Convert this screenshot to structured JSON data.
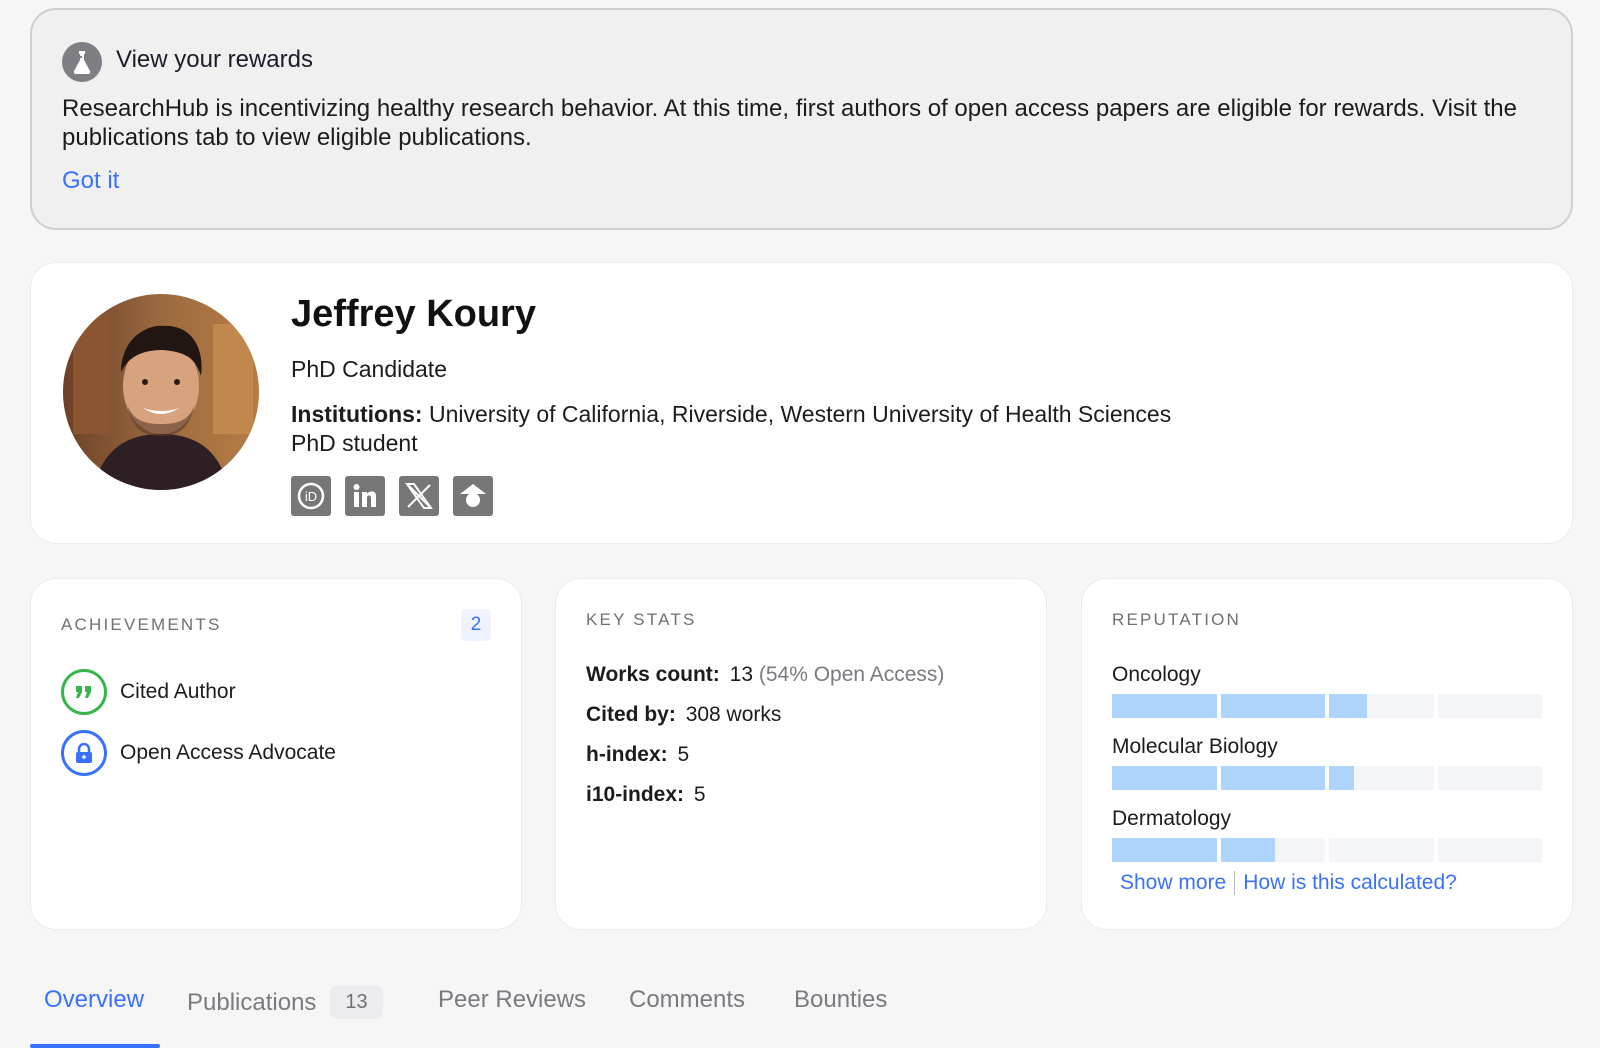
{
  "banner": {
    "icon": "flask-icon",
    "title": "View your rewards",
    "text": "ResearchHub is incentivizing healthy research behavior. At this time, first authors of open access papers are eligible for rewards. Visit the publications tab to view eligible publications.",
    "link": "Got it"
  },
  "profile": {
    "name": "Jeffrey Koury",
    "role": "PhD Candidate",
    "institutions_label": "Institutions:",
    "institutions": "University of California, Riverside, Western University of Health Sciences",
    "headline": "PhD student",
    "socials": [
      "orcid-icon",
      "linkedin-icon",
      "x-icon",
      "google-scholar-icon"
    ]
  },
  "achievements": {
    "title": "ACHIEVEMENTS",
    "count": "2",
    "items": [
      {
        "label": "Cited Author",
        "icon": "quote-icon",
        "color": "#38b44a"
      },
      {
        "label": "Open Access Advocate",
        "icon": "lock-icon",
        "color": "#3971ff"
      }
    ]
  },
  "key_stats": {
    "title": "KEY STATS",
    "works_label": "Works count:",
    "works_value": "13",
    "works_note": "(54% Open Access)",
    "cited_label": "Cited by:",
    "cited_value": "308 works",
    "h_label": "h-index:",
    "h_value": "5",
    "i10_label": "i10-index:",
    "i10_value": "5"
  },
  "reputation": {
    "title": "REPUTATION",
    "items": [
      {
        "label": "Oncology",
        "level": 0.59
      },
      {
        "label": "Molecular Biology",
        "level": 0.56
      },
      {
        "label": "Dermatology",
        "level": 0.38
      }
    ],
    "show_more": "Show more",
    "how": "How is this calculated?"
  },
  "tabs": [
    {
      "label": "Overview",
      "active": true
    },
    {
      "label": "Publications",
      "badge": "13"
    },
    {
      "label": "Peer Reviews"
    },
    {
      "label": "Comments"
    },
    {
      "label": "Bounties"
    }
  ],
  "colors": {
    "accent": "#3971ff",
    "bar_fill": "#aed4fb",
    "success": "#38b44a"
  }
}
